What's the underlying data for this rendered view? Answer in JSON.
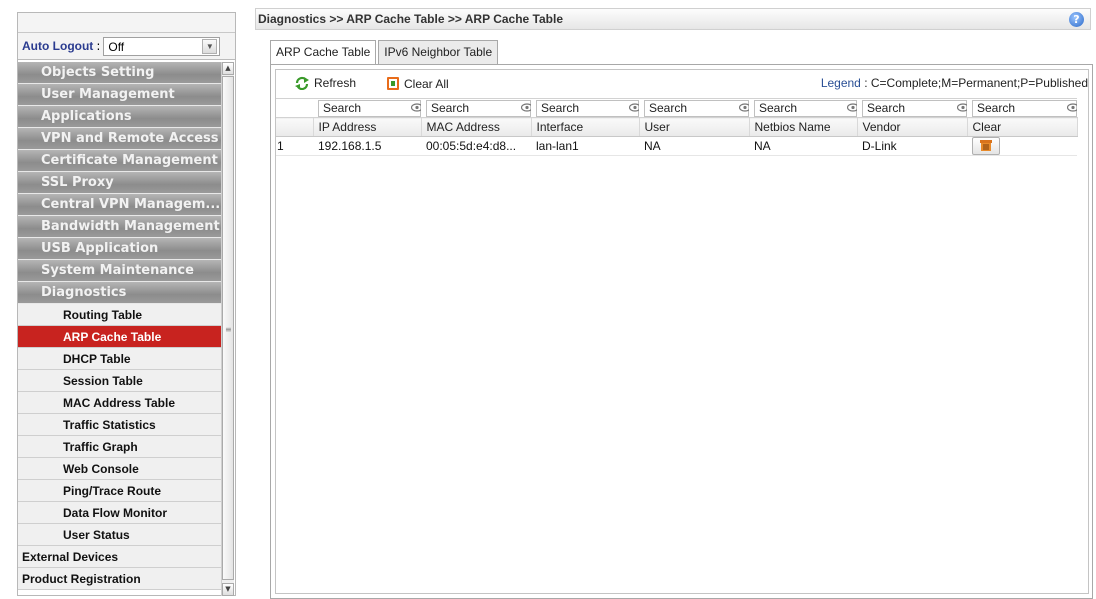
{
  "autologout": {
    "label": "Auto Logout",
    "value": "Off"
  },
  "menu": {
    "categories": [
      "Objects Setting",
      "User Management",
      "Applications",
      "VPN and Remote Access",
      "Certificate Management",
      "SSL Proxy",
      "Central VPN Managem...",
      "Bandwidth Management",
      "USB Application",
      "System Maintenance",
      "Diagnostics"
    ],
    "diagnostics_items": [
      "Routing Table",
      "ARP Cache Table",
      "DHCP Table",
      "Session Table",
      "MAC Address Table",
      "Traffic Statistics",
      "Traffic Graph",
      "Web Console",
      "Ping/Trace Route",
      "Data Flow Monitor",
      "User Status"
    ],
    "bottom_items": [
      "External Devices",
      "Product Registration"
    ]
  },
  "breadcrumb": "Diagnostics >> ARP Cache Table >> ARP Cache Table",
  "tabs": [
    "ARP Cache Table",
    "IPv6 Neighbor Table"
  ],
  "toolbar": {
    "refresh_label": "Refresh",
    "clear_all_label": "Clear All",
    "legend_label": "Legend",
    "legend_text": "C=Complete;M=Permanent;P=Published"
  },
  "table": {
    "search_placeholder": "Search",
    "columns": [
      "IP Address",
      "MAC Address",
      "Interface",
      "User",
      "Netbios Name",
      "Vendor",
      "Clear"
    ],
    "rows": [
      {
        "index": "1",
        "ip": "192.168.1.5",
        "mac": "00:05:5d:e4:d8...",
        "interface": "lan-lan1",
        "user": "NA",
        "netbios": "NA",
        "vendor": "D-Link"
      }
    ]
  },
  "colors": {
    "accent_active": "#c8231f",
    "category_bg": "#9a9a9a"
  }
}
